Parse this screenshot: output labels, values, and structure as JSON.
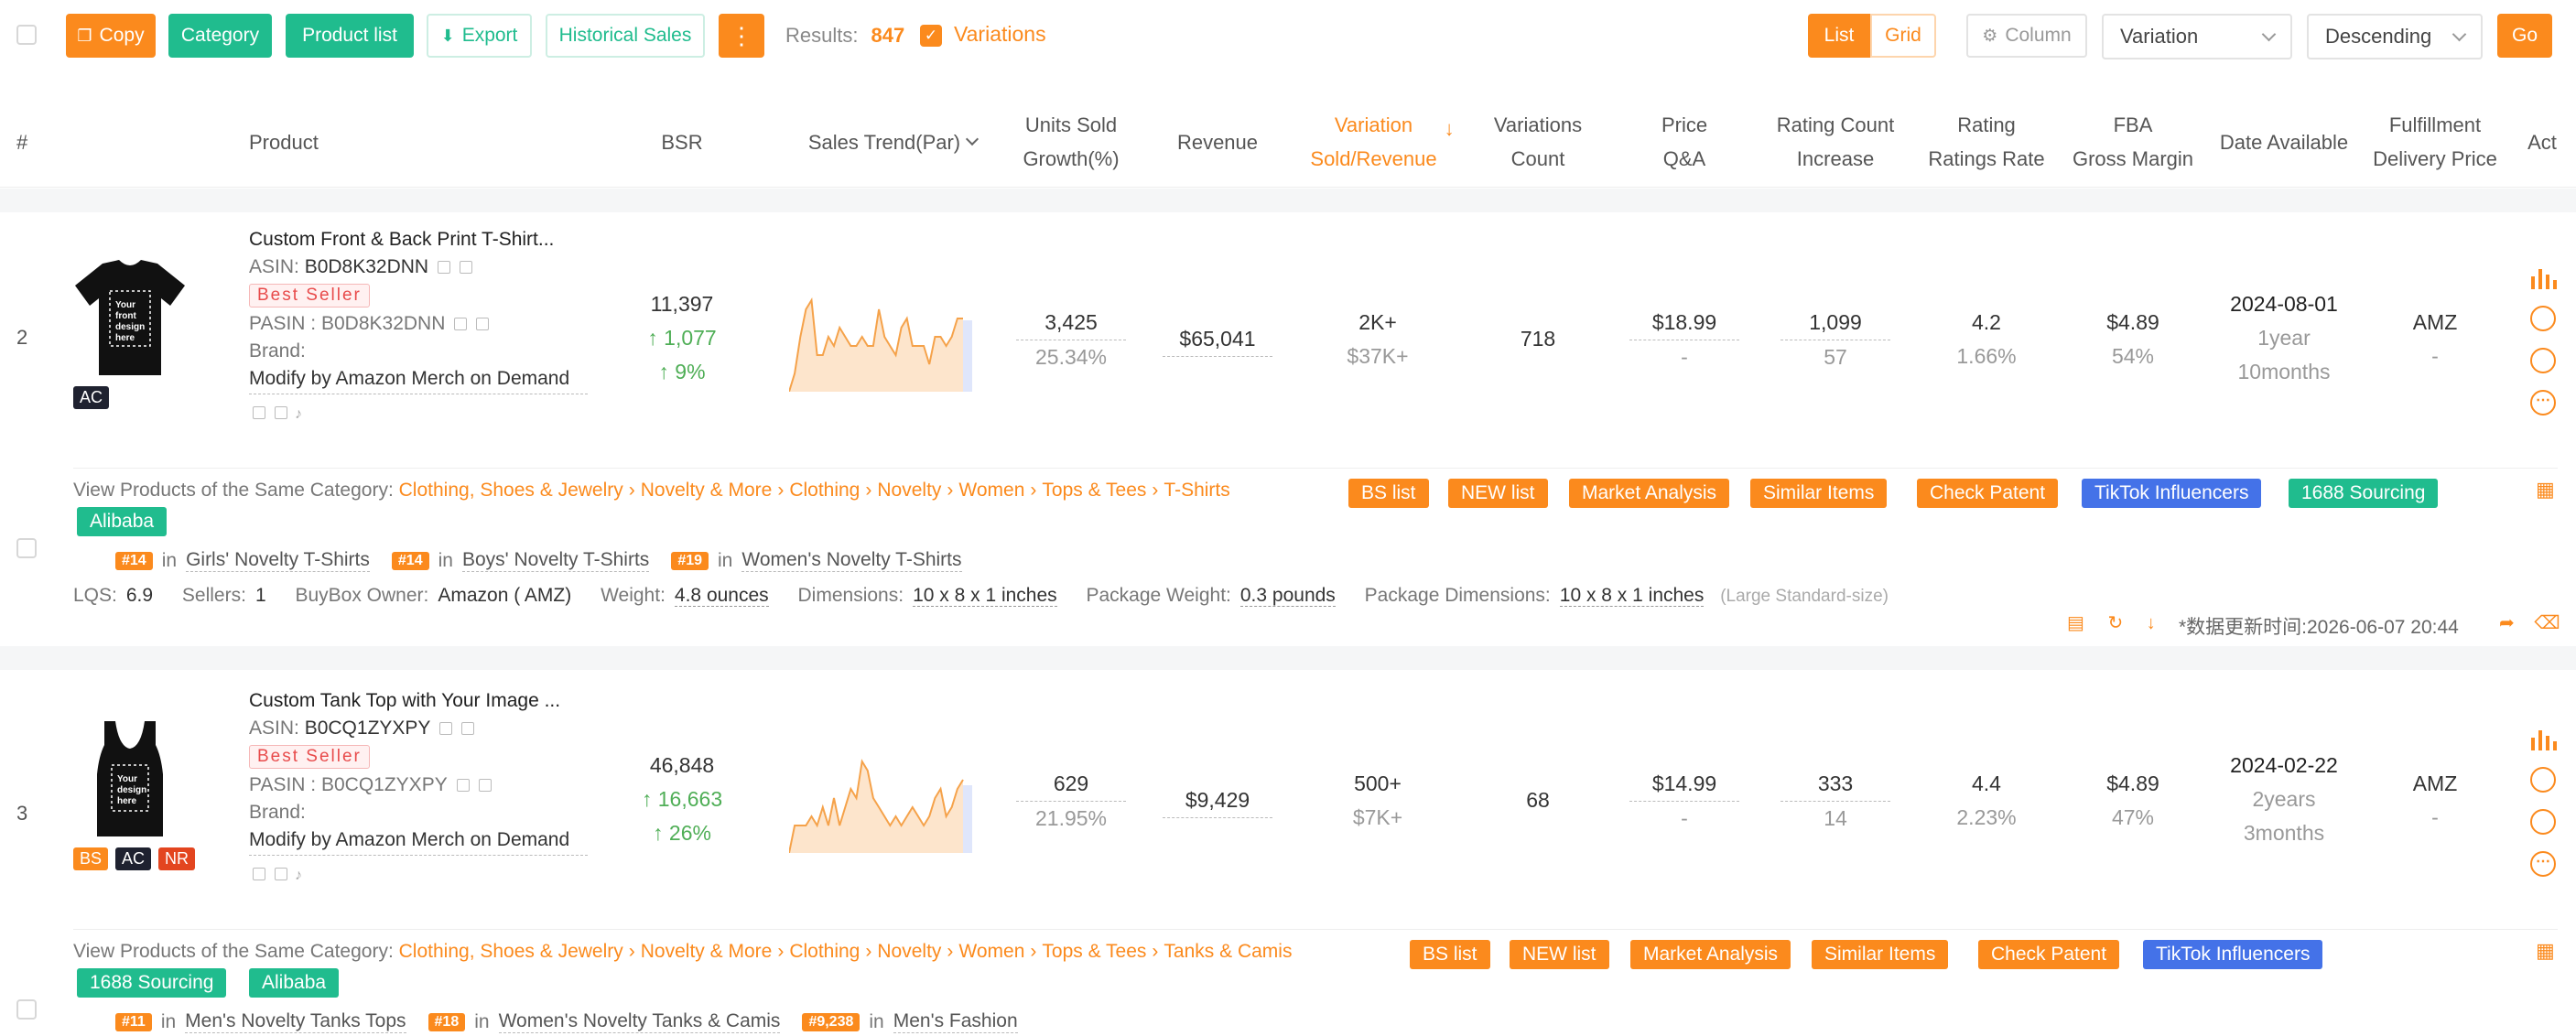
{
  "toolbar": {
    "copy": "Copy",
    "category": "Category",
    "product_list": "Product list",
    "export": "Export",
    "historical_sales": "Historical Sales",
    "more": "⋮",
    "results_label": "Results:",
    "results_count": "847",
    "variations": "Variations",
    "list": "List",
    "grid": "Grid",
    "column": "Column",
    "sort_field": "Variation",
    "sort_order": "Descending",
    "go": "Go"
  },
  "header": {
    "idx": "#",
    "product": "Product",
    "bsr": "BSR",
    "sales_trend": "Sales Trend(Par)",
    "units_l1": "Units Sold",
    "units_l2": "Growth(%)",
    "revenue": "Revenue",
    "var_l1": "Variation",
    "var_l2": "Sold/Revenue",
    "varc_l1": "Variations",
    "varc_l2": "Count",
    "price_l1": "Price",
    "price_l2": "Q&A",
    "rc_l1": "Rating Count",
    "rc_l2": "Increase",
    "rating_l1": "Rating",
    "rating_l2": "Ratings Rate",
    "fba_l1": "FBA",
    "fba_l2": "Gross Margin",
    "date": "Date Available",
    "ful_l1": "Fulfillment",
    "ful_l2": "Delivery Price",
    "act": "Act"
  },
  "colors": {
    "accent": "#fb8a1d",
    "green": "#20bc8e",
    "blue": "#4472e8",
    "trend_fill": "#fde5cc"
  },
  "rows": [
    {
      "rank": "2",
      "title": "Custom Front & Back Print T-Shirt...",
      "asin_label": "ASIN:",
      "asin": "B0D8K32DNN",
      "best_seller": "Best Seller",
      "pasin_label": "PASIN :",
      "pasin": "B0D8K32DNN",
      "brand_label": "Brand:",
      "brand": "Modify by Amazon Merch on Demand",
      "thumb_text": "Your front design here",
      "tags": [
        "AC"
      ],
      "bsr": "11,397",
      "bsr_change": "↑ 1,077",
      "bsr_pct": "↑ 9%",
      "trend": [
        0,
        2,
        6,
        9,
        10,
        4,
        4,
        6,
        5,
        7,
        6,
        5,
        5,
        6,
        5,
        5,
        9,
        6,
        5,
        4,
        7,
        8,
        5,
        5,
        5,
        3,
        6,
        6,
        5,
        6,
        8,
        8
      ],
      "units": "3,425",
      "units_growth": "25.34%",
      "revenue": "$65,041",
      "var_sold": "2K+",
      "var_rev": "$37K+",
      "var_count": "718",
      "price": "$18.99",
      "qa": "-",
      "rating_count": "1,099",
      "rating_inc": "57",
      "rating": "4.2",
      "rating_rate": "1.66%",
      "fba": "$4.89",
      "margin": "54%",
      "date": "2024-08-01",
      "age_l1": "1year",
      "age_l2": "10months",
      "fulfillment": "AMZ",
      "delivery": "-",
      "cat_label": "View Products of the Same Category:",
      "category": [
        "Clothing, Shoes & Jewelry",
        "Novelty & More",
        "Clothing",
        "Novelty",
        "Women",
        "Tops & Tees",
        "T-Shirts"
      ],
      "pills": [
        "BS list",
        "NEW list",
        "Market Analysis",
        "Similar Items",
        "Check Patent",
        "TikTok Influencers",
        "1688 Sourcing",
        "Alibaba"
      ],
      "ranks": [
        {
          "tag": "#14",
          "in": "in",
          "name": "Girls' Novelty T-Shirts"
        },
        {
          "tag": "#14",
          "in": "in",
          "name": "Boys' Novelty T-Shirts"
        },
        {
          "tag": "#19",
          "in": "in",
          "name": "Women's Novelty T-Shirts"
        }
      ],
      "lqs_label": "LQS:",
      "lqs": "6.9",
      "sellers_label": "Sellers:",
      "sellers": "1",
      "buybox_label": "BuyBox Owner:",
      "buybox": "Amazon ( AMZ)",
      "weight_label": "Weight:",
      "weight": "4.8 ounces",
      "dims_label": "Dimensions:",
      "dims": "10 x 8 x 1 inches",
      "pkgw_label": "Package Weight:",
      "pkgw": "0.3 pounds",
      "pkgd_label": "Package Dimensions:",
      "pkgd": "10 x 8 x 1 inches",
      "size_tier": "(Large Standard-size)",
      "updated": "*数据更新时间:2026-06-07 20:44"
    },
    {
      "rank": "3",
      "title": "Custom Tank Top with Your Image ...",
      "asin_label": "ASIN:",
      "asin": "B0CQ1ZYXPY",
      "best_seller": "Best Seller",
      "pasin_label": "PASIN :",
      "pasin": "B0CQ1ZYXPY",
      "brand_label": "Brand:",
      "brand": "Modify by Amazon Merch on Demand",
      "thumb_text": "Your design here",
      "tags": [
        "BS",
        "AC",
        "NR"
      ],
      "bsr": "46,848",
      "bsr_change": "↑ 16,663",
      "bsr_pct": "↑ 26%",
      "trend": [
        0,
        3,
        3,
        3,
        4,
        3,
        5,
        3,
        6,
        3,
        5,
        7,
        6,
        10,
        9,
        6,
        5,
        4,
        3,
        4,
        3,
        4,
        5,
        4,
        3,
        4,
        6,
        7,
        4,
        5,
        7,
        8
      ],
      "units": "629",
      "units_growth": "21.95%",
      "revenue": "$9,429",
      "var_sold": "500+",
      "var_rev": "$7K+",
      "var_count": "68",
      "price": "$14.99",
      "qa": "-",
      "rating_count": "333",
      "rating_inc": "14",
      "rating": "4.4",
      "rating_rate": "2.23%",
      "fba": "$4.89",
      "margin": "47%",
      "date": "2024-02-22",
      "age_l1": "2years",
      "age_l2": "3months",
      "fulfillment": "AMZ",
      "delivery": "-",
      "cat_label": "View Products of the Same Category:",
      "category": [
        "Clothing, Shoes & Jewelry",
        "Novelty & More",
        "Clothing",
        "Novelty",
        "Women",
        "Tops & Tees",
        "Tanks & Camis"
      ],
      "pills": [
        "BS list",
        "NEW list",
        "Market Analysis",
        "Similar Items",
        "Check Patent",
        "TikTok Influencers",
        "1688 Sourcing",
        "Alibaba"
      ],
      "ranks": [
        {
          "tag": "#11",
          "in": "in",
          "name": "Men's Novelty Tanks Tops"
        },
        {
          "tag": "#18",
          "in": "in",
          "name": "Women's Novelty Tanks & Camis"
        },
        {
          "tag": "#9,238",
          "in": "in",
          "name": "Men's Fashion"
        }
      ]
    }
  ]
}
